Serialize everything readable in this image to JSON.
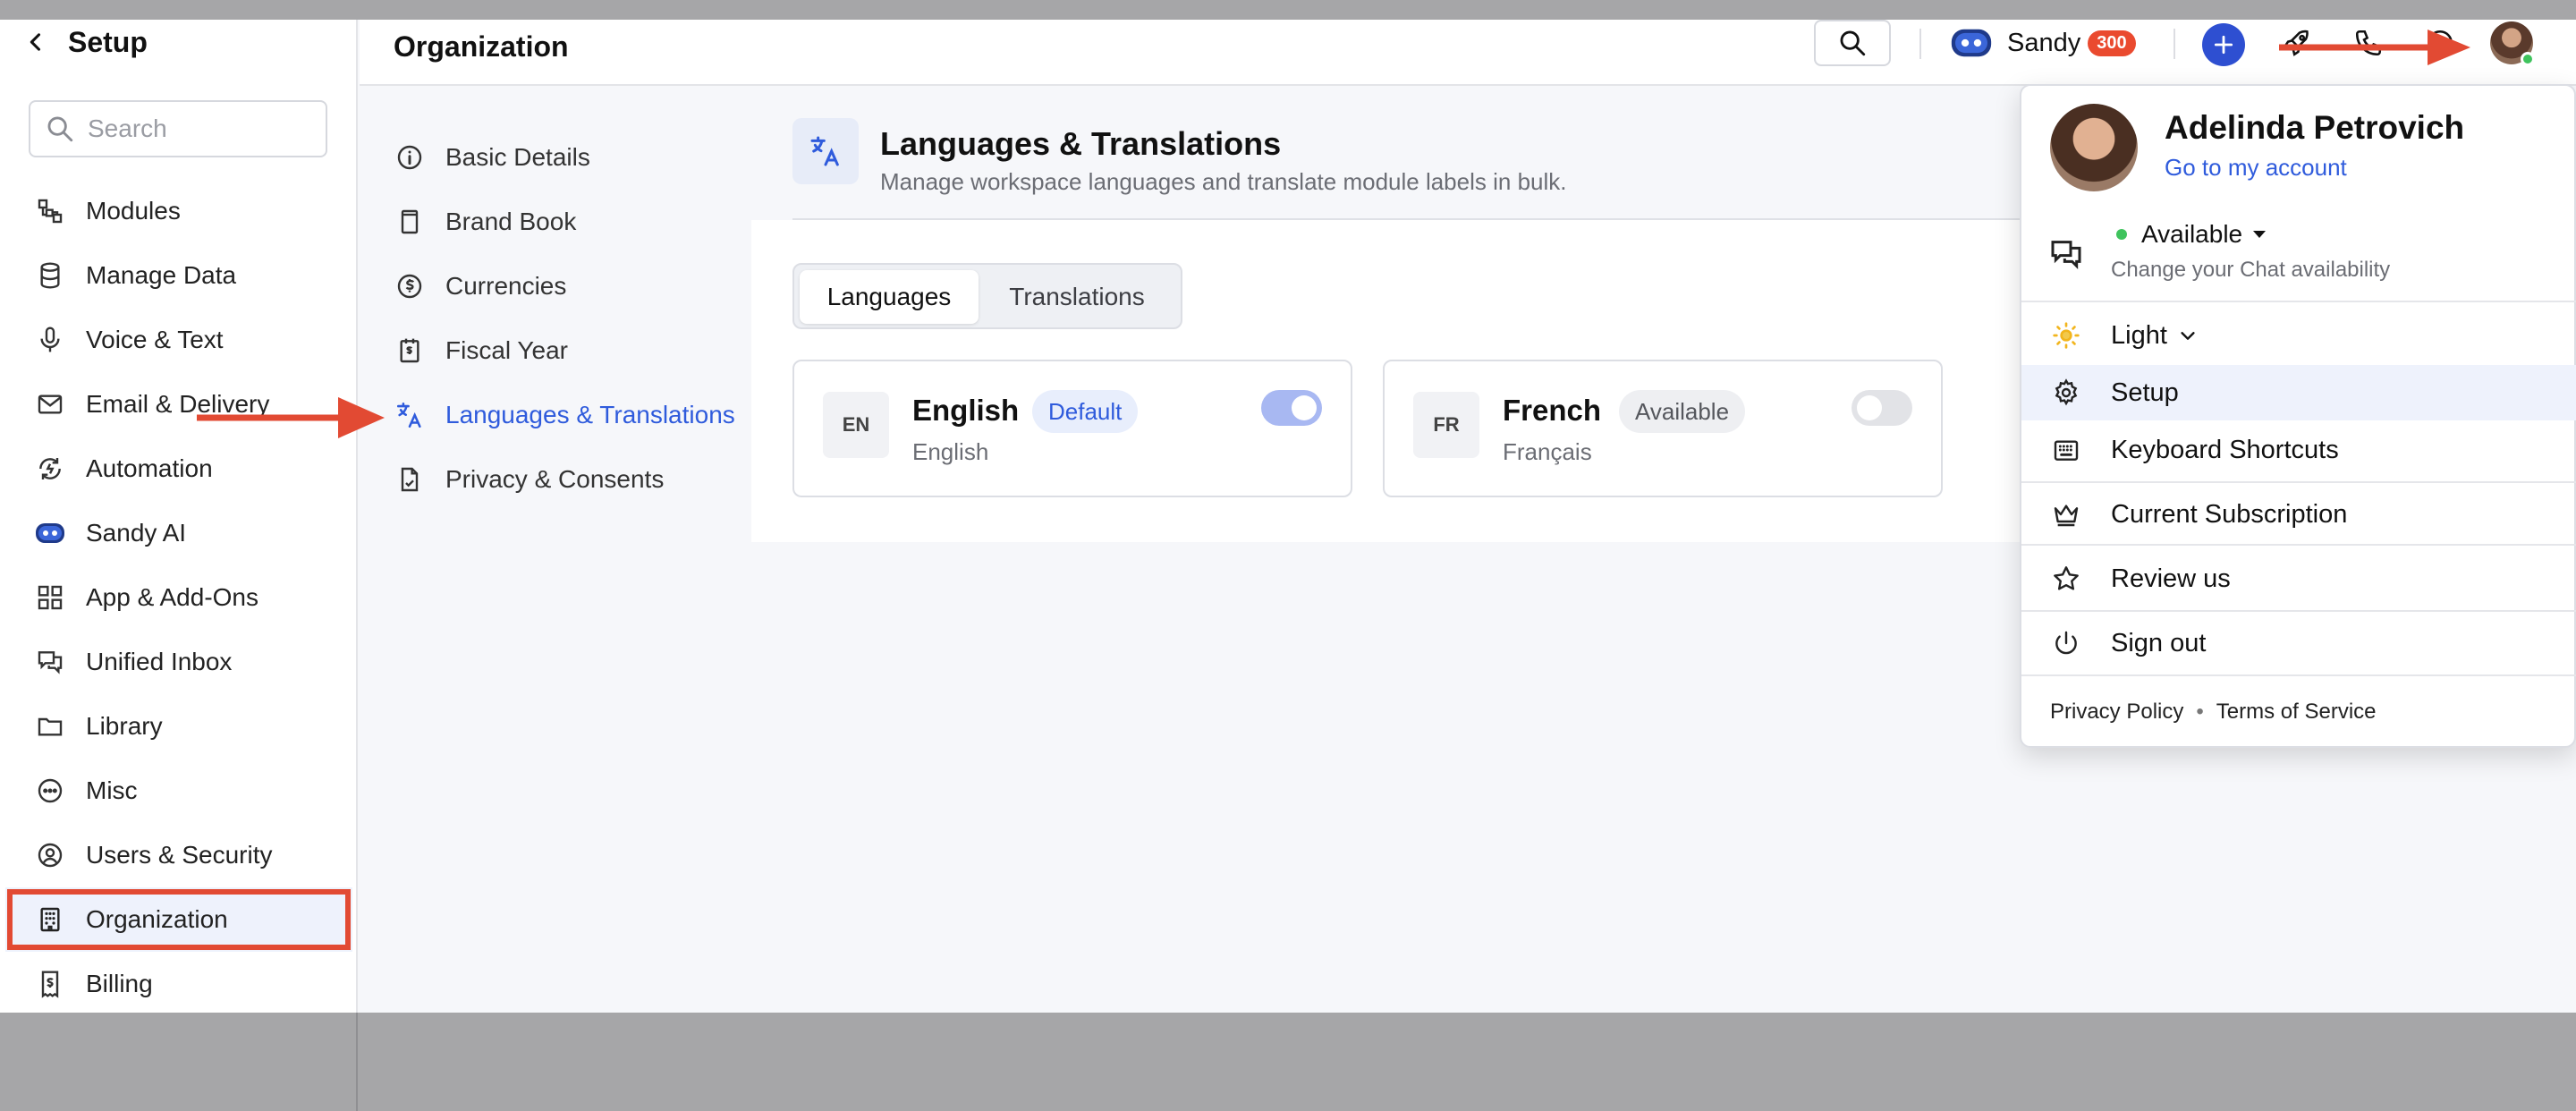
{
  "sidebar": {
    "title": "Setup",
    "search_placeholder": "Search",
    "items": [
      {
        "label": "Modules",
        "icon": "modules-icon"
      },
      {
        "label": "Manage Data",
        "icon": "database-icon"
      },
      {
        "label": "Voice & Text",
        "icon": "microphone-icon"
      },
      {
        "label": "Email & Delivery",
        "icon": "envelope-icon"
      },
      {
        "label": "Automation",
        "icon": "automation-icon"
      },
      {
        "label": "Sandy AI",
        "icon": "sandy-ai-icon"
      },
      {
        "label": "App & Add-Ons",
        "icon": "grid-icon"
      },
      {
        "label": "Unified Inbox",
        "icon": "inbox-icon"
      },
      {
        "label": "Library",
        "icon": "folder-icon"
      },
      {
        "label": "Misc",
        "icon": "more-icon"
      },
      {
        "label": "Users & Security",
        "icon": "user-circle-icon"
      },
      {
        "label": "Organization",
        "icon": "building-icon",
        "active": true
      },
      {
        "label": "Billing",
        "icon": "billing-icon"
      }
    ]
  },
  "header": {
    "page_title": "Organization",
    "sandy_label": "Sandy",
    "sandy_badge": "300"
  },
  "org_nav": {
    "items": [
      {
        "label": "Basic Details",
        "icon": "info-icon"
      },
      {
        "label": "Brand Book",
        "icon": "book-icon"
      },
      {
        "label": "Currencies",
        "icon": "currency-icon"
      },
      {
        "label": "Fiscal Year",
        "icon": "calendar-icon"
      },
      {
        "label": "Languages & Translations",
        "icon": "translate-icon",
        "active": true
      },
      {
        "label": "Privacy & Consents",
        "icon": "document-check-icon"
      }
    ]
  },
  "content": {
    "title": "Languages & Translations",
    "subtitle": "Manage workspace languages and translate module labels in bulk.",
    "tabs": [
      "Languages",
      "Translations"
    ],
    "selected_tab": "Languages",
    "languages": [
      {
        "code": "EN",
        "name": "English",
        "native": "English",
        "badge": "Default",
        "enabled": true
      },
      {
        "code": "FR",
        "name": "French",
        "native": "Français",
        "badge": "Available",
        "enabled": false
      }
    ]
  },
  "profile_menu": {
    "name": "Adelinda Petrovich",
    "account_link": "Go to my account",
    "status": "Available",
    "status_sub": "Change your Chat availability",
    "theme": "Light",
    "items": [
      "Setup",
      "Keyboard Shortcuts",
      "Current Subscription",
      "Review us",
      "Sign out"
    ],
    "footer_privacy": "Privacy Policy",
    "footer_bullet": "•",
    "footer_terms": "Terms of Service"
  },
  "colors": {
    "accent": "#2f5bdc",
    "highlight_box": "#e24a33",
    "arrow": "#e24a33",
    "badge": "#ea4a2f",
    "online": "#3fc35d"
  }
}
